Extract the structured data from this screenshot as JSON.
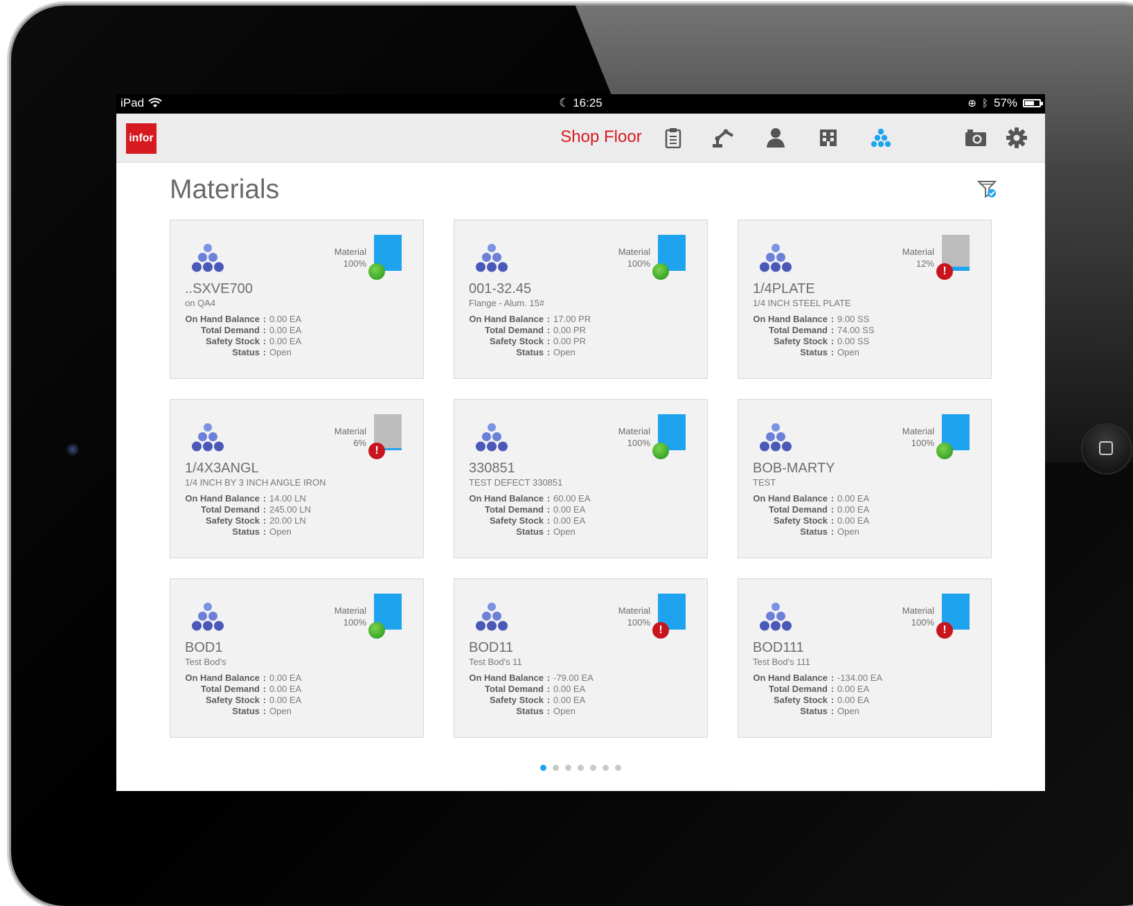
{
  "statusbar": {
    "device": "iPad",
    "time": "16:25",
    "battery": "57%"
  },
  "header": {
    "logo": "infor",
    "title": "Shop Floor",
    "accent": "#d71920",
    "nav_icons": [
      "clipboard-icon",
      "robot-arm-icon",
      "person-icon",
      "building-icon",
      "materials-icon",
      "camera-icon",
      "gear-icon"
    ]
  },
  "page": {
    "title": "Materials"
  },
  "colors": {
    "bar_fill": "#1ea3ef",
    "bar_empty": "#bdbdbd",
    "ok": "#3aa52a",
    "error": "#c8141c"
  },
  "cards": [
    {
      "name": "..SXVE700",
      "desc": "on QA4",
      "material_label": "Material",
      "material_pct": "100%",
      "fill": 1.0,
      "status_icon": "ok",
      "on_hand_label": "On Hand Balance",
      "on_hand": "0.00 EA",
      "demand_label": "Total Demand",
      "demand": "0.00 EA",
      "safety_label": "Safety Stock",
      "safety": "0.00 EA",
      "status_label": "Status",
      "status": "Open"
    },
    {
      "name": "001-32.45",
      "desc": "Flange - Alum. 15#",
      "material_label": "Material",
      "material_pct": "100%",
      "fill": 1.0,
      "status_icon": "ok",
      "on_hand_label": "On Hand Balance",
      "on_hand": "17.00 PR",
      "demand_label": "Total Demand",
      "demand": "0.00 PR",
      "safety_label": "Safety Stock",
      "safety": "0.00 PR",
      "status_label": "Status",
      "status": "Open"
    },
    {
      "name": "1/4PLATE",
      "desc": "1/4 INCH STEEL PLATE",
      "material_label": "Material",
      "material_pct": "12%",
      "fill": 0.12,
      "status_icon": "err",
      "on_hand_label": "On Hand Balance",
      "on_hand": "9.00 SS",
      "demand_label": "Total Demand",
      "demand": "74.00 SS",
      "safety_label": "Safety Stock",
      "safety": "0.00 SS",
      "status_label": "Status",
      "status": "Open"
    },
    {
      "name": "1/4X3ANGL",
      "desc": "1/4 INCH BY 3 INCH ANGLE IRON",
      "material_label": "Material",
      "material_pct": "6%",
      "fill": 0.06,
      "status_icon": "err",
      "on_hand_label": "On Hand Balance",
      "on_hand": "14.00 LN",
      "demand_label": "Total Demand",
      "demand": "245.00 LN",
      "safety_label": "Safety Stock",
      "safety": "20.00 LN",
      "status_label": "Status",
      "status": "Open"
    },
    {
      "name": "330851",
      "desc": "TEST DEFECT 330851",
      "material_label": "Material",
      "material_pct": "100%",
      "fill": 1.0,
      "status_icon": "ok",
      "on_hand_label": "On Hand Balance",
      "on_hand": "60.00 EA",
      "demand_label": "Total Demand",
      "demand": "0.00 EA",
      "safety_label": "Safety Stock",
      "safety": "0.00 EA",
      "status_label": "Status",
      "status": "Open"
    },
    {
      "name": "BOB-MARTY",
      "desc": "TEST",
      "material_label": "Material",
      "material_pct": "100%",
      "fill": 1.0,
      "status_icon": "ok",
      "on_hand_label": "On Hand Balance",
      "on_hand": "0.00 EA",
      "demand_label": "Total Demand",
      "demand": "0.00 EA",
      "safety_label": "Safety Stock",
      "safety": "0.00 EA",
      "status_label": "Status",
      "status": "Open"
    },
    {
      "name": "BOD1",
      "desc": "Test Bod's",
      "material_label": "Material",
      "material_pct": "100%",
      "fill": 1.0,
      "status_icon": "ok",
      "on_hand_label": "On Hand Balance",
      "on_hand": "0.00 EA",
      "demand_label": "Total Demand",
      "demand": "0.00 EA",
      "safety_label": "Safety Stock",
      "safety": "0.00 EA",
      "status_label": "Status",
      "status": "Open"
    },
    {
      "name": "BOD11",
      "desc": "Test Bod's 11",
      "material_label": "Material",
      "material_pct": "100%",
      "fill": 1.0,
      "status_icon": "err",
      "on_hand_label": "On Hand Balance",
      "on_hand": "-79.00 EA",
      "demand_label": "Total Demand",
      "demand": "0.00 EA",
      "safety_label": "Safety Stock",
      "safety": "0.00 EA",
      "status_label": "Status",
      "status": "Open"
    },
    {
      "name": "BOD111",
      "desc": "Test Bod's 111",
      "material_label": "Material",
      "material_pct": "100%",
      "fill": 1.0,
      "status_icon": "err",
      "on_hand_label": "On Hand Balance",
      "on_hand": "-134.00 EA",
      "demand_label": "Total Demand",
      "demand": "0.00 EA",
      "safety_label": "Safety Stock",
      "safety": "0.00 EA",
      "status_label": "Status",
      "status": "Open"
    }
  ],
  "pagination": {
    "pages": 7,
    "current": 1
  }
}
